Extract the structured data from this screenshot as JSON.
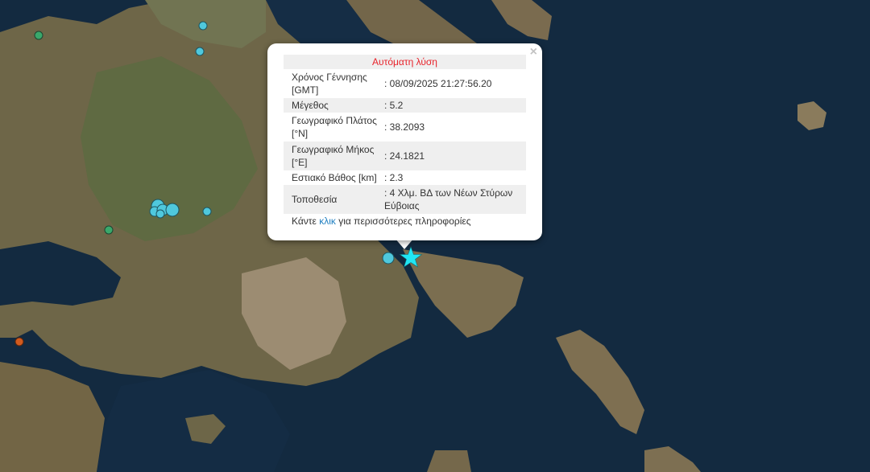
{
  "popup": {
    "title": "Αυτόματη λύση",
    "close_label": "×",
    "rows": [
      {
        "label": "Χρόνος Γέννησης [GMT]",
        "value": ": 08/09/2025 21:27:56.20"
      },
      {
        "label": "Μέγεθος",
        "value": ": 5.2"
      },
      {
        "label": "Γεωγραφικό Πλάτος [°N]",
        "value": ": 38.2093"
      },
      {
        "label": "Γεωγραφικό Μήκος [°E]",
        "value": ": 24.1821"
      },
      {
        "label": "Εστιακό Βάθος [km]",
        "value": ": 2.3"
      },
      {
        "label": "Τοποθεσία",
        "value": ": 4 Χλμ. ΒΔ των Νέων Στύρων Εύβοιας"
      }
    ],
    "more_prefix": "Κάντε ",
    "more_link": "κλικ",
    "more_suffix": " για περισσότερες πληροφορίες"
  },
  "colors": {
    "sea": "#12263b",
    "land": "#7a6a4c",
    "quake_marker": "#4fc8dd",
    "older_marker": "#3aa86b",
    "deep_marker": "#d15a1e",
    "epicenter_star": "#21e6f4",
    "title_red": "#e8232b",
    "link_blue": "#1f7fc1"
  }
}
